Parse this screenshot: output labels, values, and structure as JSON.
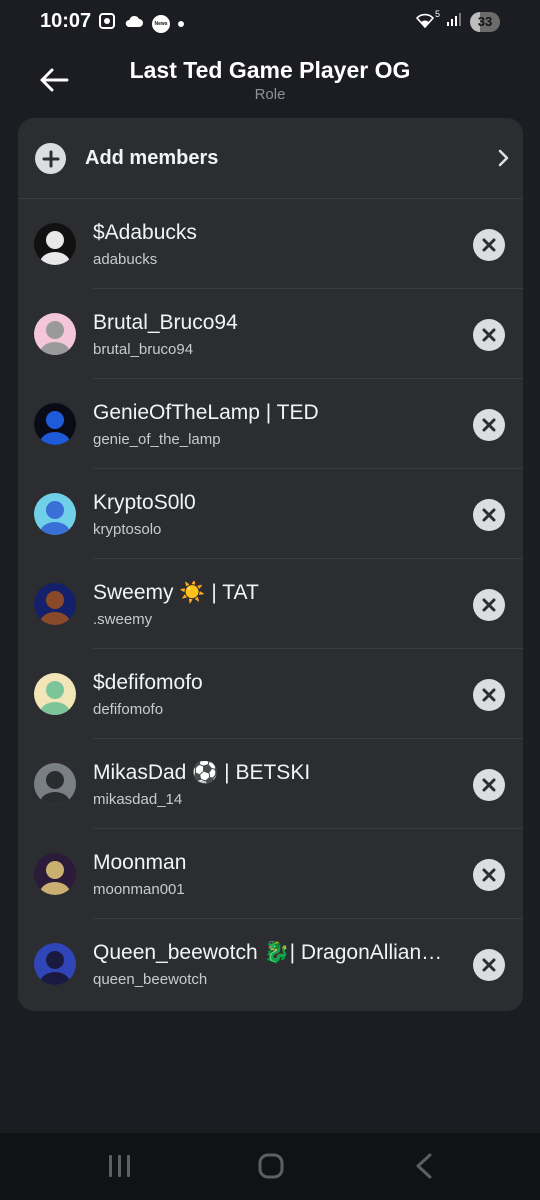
{
  "status_bar": {
    "time": "10:07",
    "news_label": "News",
    "wifi_label": "5",
    "battery": "33"
  },
  "header": {
    "title": "Last Ted Game Player OG",
    "subtitle": "Role"
  },
  "add_members": {
    "label": "Add members"
  },
  "members": [
    {
      "name": "$Adabucks",
      "username": "adabucks",
      "avatar_color": "#111111",
      "avatar_accent": "#e8e8e8"
    },
    {
      "name": "Brutal_Bruco94",
      "username": "brutal_bruco94",
      "avatar_color": "#f3c6d8",
      "avatar_accent": "#9a9a9a"
    },
    {
      "name": "GenieOfTheLamp | TED",
      "username": "genie_of_the_lamp",
      "avatar_color": "#0b0b18",
      "avatar_accent": "#1f5ad8"
    },
    {
      "name": "KryptoS0l0",
      "username": "kryptosolo",
      "avatar_color": "#6fd0e8",
      "avatar_accent": "#3b6fd8"
    },
    {
      "name": "Sweemy ☀️ | TAT",
      "username": ".sweemy",
      "avatar_color": "#14206a",
      "avatar_accent": "#8a4a2a"
    },
    {
      "name": "$defifomofo",
      "username": "defifomofo",
      "avatar_color": "#f2e6b8",
      "avatar_accent": "#7cc49a"
    },
    {
      "name": "MikasDad ⚽ | BETSKI",
      "username": "mikasdad_14",
      "avatar_color": "#7a7f86",
      "avatar_accent": "#2a2c30"
    },
    {
      "name": "Moonman",
      "username": "moonman001",
      "avatar_color": "#2b1a3a",
      "avatar_accent": "#c9b070"
    },
    {
      "name": "Queen_beewotch 🐉| DragonAllian…",
      "username": "queen_beewotch",
      "avatar_color": "#3046b8",
      "avatar_accent": "#1a1a40"
    }
  ]
}
